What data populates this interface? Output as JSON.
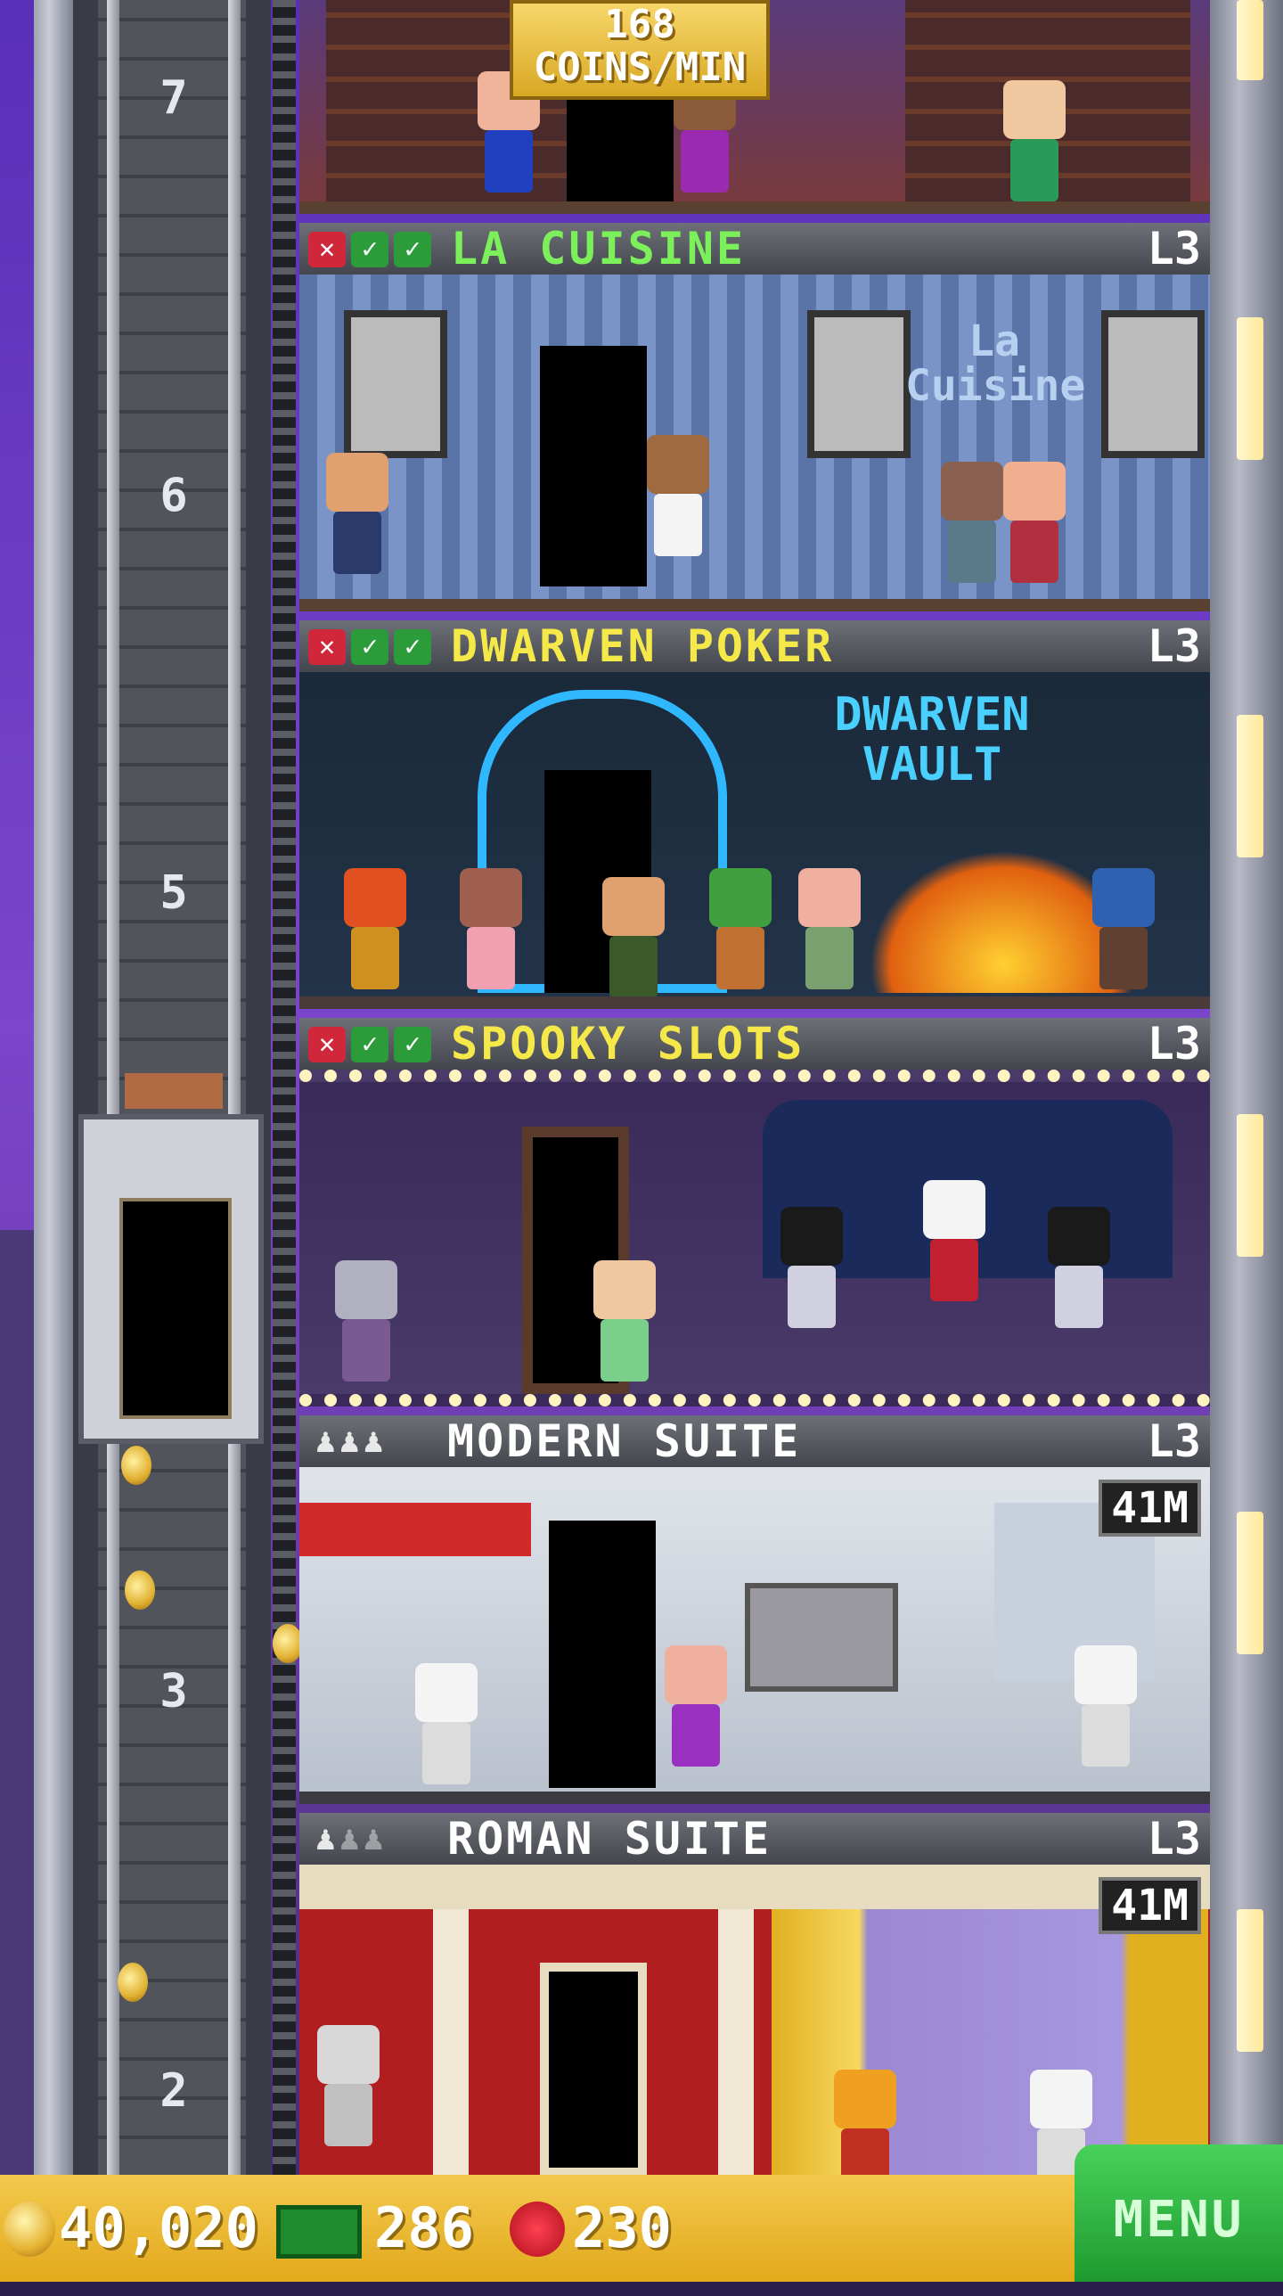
{
  "coins_banner": {
    "value": "168",
    "unit": "COINS/MIN"
  },
  "floor_numbers": {
    "f7": "7",
    "f6": "6",
    "f5": "5",
    "f3": "3",
    "f2": "2"
  },
  "floors": [
    {
      "name": "LA CUISINE",
      "level": "L3",
      "name_color": "#7cf05a"
    },
    {
      "name": "DWARVEN POKER",
      "level": "L3",
      "name_color": "#f5e94a"
    },
    {
      "name": "SPOOKY SLOTS",
      "level": "L3",
      "name_color": "#f5e94a"
    },
    {
      "name": "MODERN SUITE",
      "level": "L3",
      "price": "41M",
      "name_color": "#ffffff"
    },
    {
      "name": "ROMAN SUITE",
      "level": "L3",
      "price": "41M",
      "name_color": "#ffffff"
    }
  ],
  "signs": {
    "la_cuisine": "La Cuisine",
    "dwarven_vault": "DWARVEN VAULT"
  },
  "stock_icons": [
    "x",
    "check",
    "check"
  ],
  "occupancy_icons": [
    "person-icon",
    "person-icon",
    "person-icon"
  ],
  "bottom_bar": {
    "coins": "40,020",
    "bux": "286",
    "gems": "230",
    "menu": "MENU"
  },
  "colors": {
    "coins": "#e5b230",
    "bux": "#1e8c2c",
    "gems": "#d0202e",
    "menu": "#2eb842"
  }
}
